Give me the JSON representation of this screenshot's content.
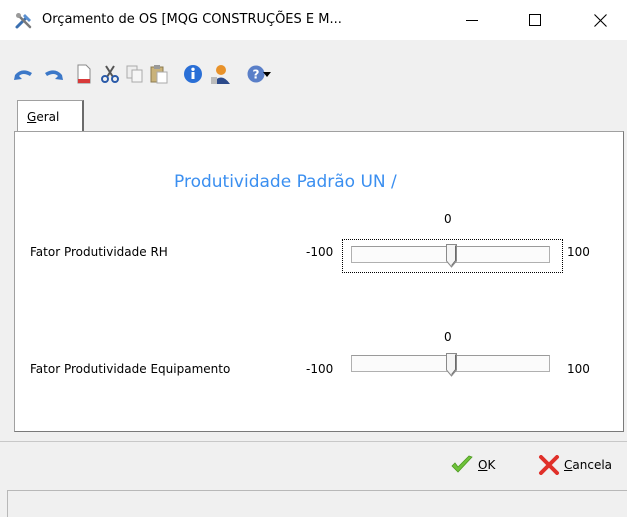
{
  "window": {
    "title": "Orçamento de OS [MQG CONSTRUÇÕES E M...",
    "app_icon": "tools-icon",
    "controls": {
      "minimize": "minimize-icon",
      "maximize": "maximize-icon",
      "close": "close-icon"
    }
  },
  "toolbar": {
    "items": [
      "undo-icon",
      "redo-icon",
      "new-document-icon",
      "cut-icon",
      "copy-icon",
      "paste-icon",
      "info-icon",
      "user-icon",
      "help-icon",
      "dropdown-arrow-icon"
    ]
  },
  "tabs": [
    {
      "label_prefix": "G",
      "label_rest": "eral",
      "active": true
    }
  ],
  "main": {
    "heading": "Produtividade Padrão  UN /",
    "rh": {
      "label": "Fator Produtividade RH",
      "value": "0",
      "min": "-100",
      "max": "100",
      "level": 0
    },
    "equip": {
      "label": "Fator Produtividade  Equipamento",
      "value": "0",
      "min": "-100",
      "max": "100",
      "level": 0
    }
  },
  "buttons": {
    "ok": {
      "underline": "O",
      "rest": "K"
    },
    "cancel": {
      "underline": "C",
      "rest": "ancela"
    }
  },
  "colors": {
    "heading": "#3b8ff0",
    "ok_check": "#6fc23a",
    "cancel_x": "#e0302a"
  }
}
